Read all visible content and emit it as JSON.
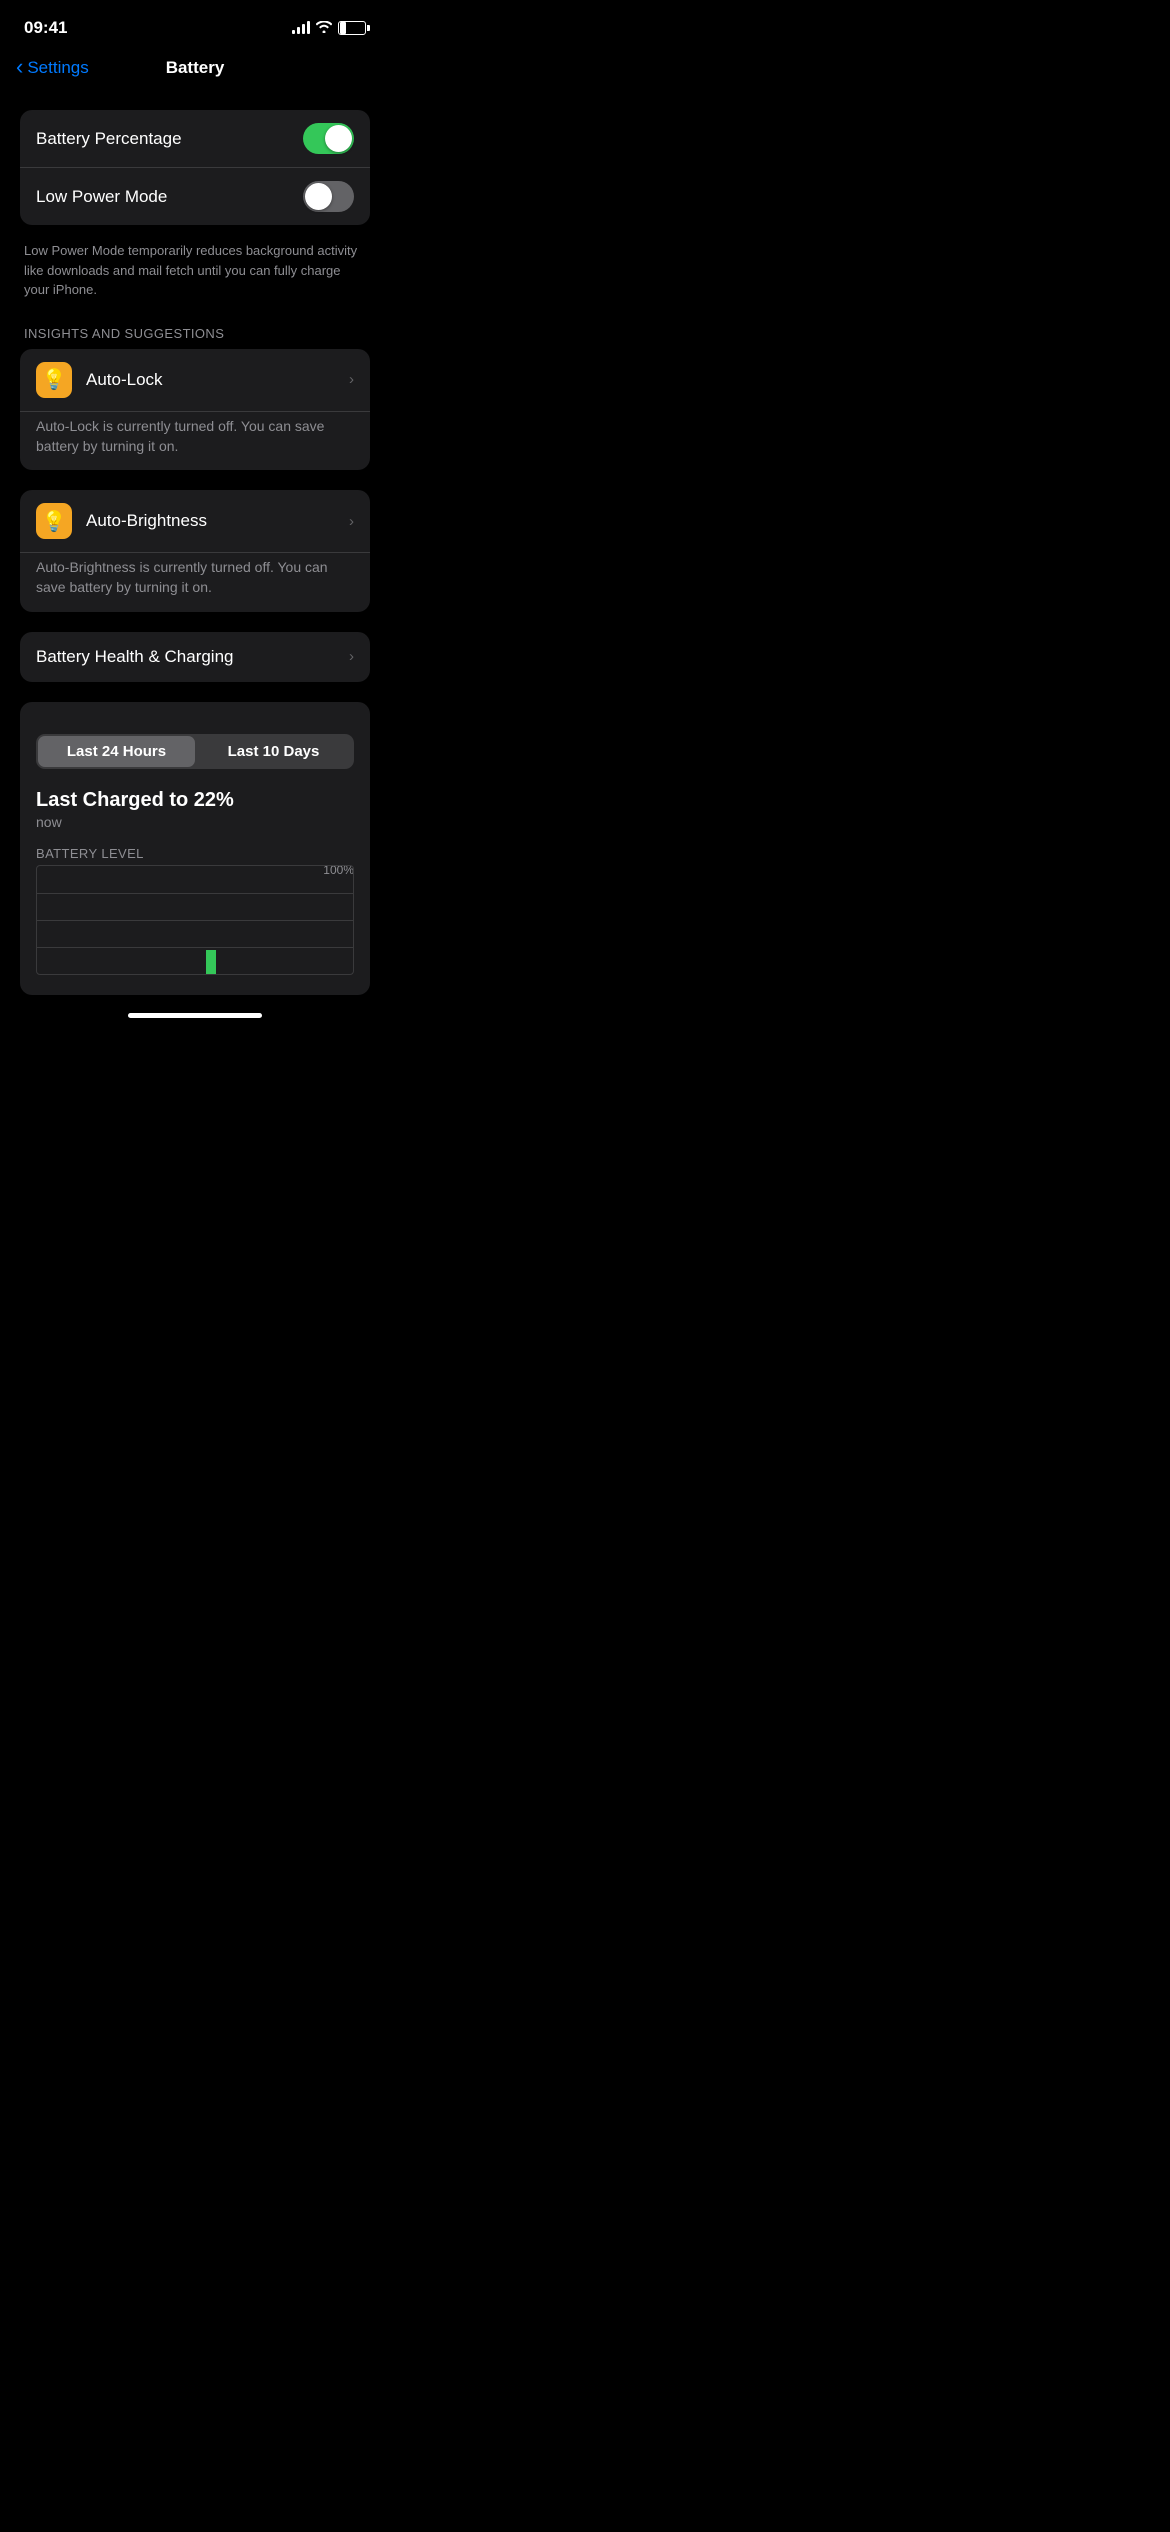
{
  "statusBar": {
    "time": "09:41",
    "batteryPercent": "22"
  },
  "nav": {
    "backLabel": "Settings",
    "title": "Battery"
  },
  "toggles": {
    "batteryPercentageLabel": "Battery Percentage",
    "batteryPercentageOn": true,
    "lowPowerModeLabel": "Low Power Mode",
    "lowPowerModeOn": false
  },
  "lowPowerNote": "Low Power Mode temporarily reduces background activity like downloads and mail fetch until you can fully charge your iPhone.",
  "insightsSection": {
    "header": "INSIGHTS AND SUGGESTIONS",
    "autoLock": {
      "label": "Auto-Lock",
      "description": "Auto-Lock is currently turned off. You can save battery by turning it on."
    },
    "autoBrightness": {
      "label": "Auto-Brightness",
      "description": "Auto-Brightness is currently turned off. You can save battery by turning it on."
    }
  },
  "batteryHealthLabel": "Battery Health & Charging",
  "timePeriod": {
    "option1": "Last 24 Hours",
    "option2": "Last 10 Days",
    "activeIndex": 0
  },
  "chart": {
    "lastChargedTitle": "Last Charged to 22%",
    "lastChargedSub": "now",
    "batteryLevelLabel": "BATTERY LEVEL",
    "maxLabel": "100%"
  }
}
